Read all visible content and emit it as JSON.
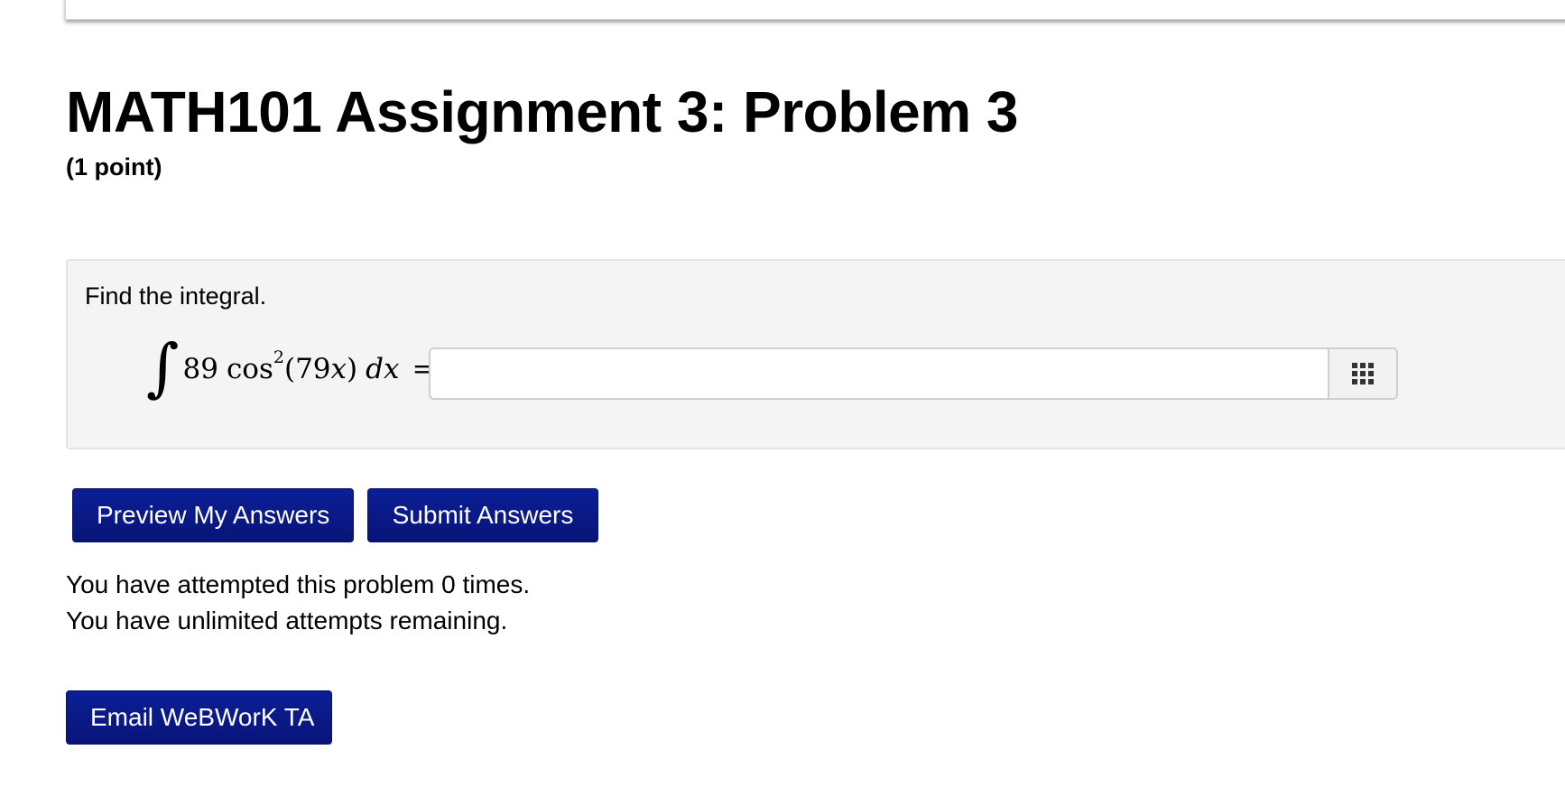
{
  "header": {
    "title": "MATH101 Assignment 3: Problem 3",
    "points": "(1 point)"
  },
  "problem": {
    "prompt": "Find the integral.",
    "integral": {
      "sign": "∫",
      "coefficient": "89",
      "function": "cos",
      "exponent": "2",
      "argument": "(79",
      "variable": "x",
      "argument_close": ")",
      "differential_d": "d",
      "differential_var": "x",
      "equals": "="
    },
    "answer_value": "",
    "palette_icon": "grid-icon"
  },
  "actions": {
    "preview_label": "Preview My Answers",
    "submit_label": "Submit Answers",
    "email_label": "Email WeBWorK TA"
  },
  "status": {
    "attempts_line": "You have attempted this problem 0 times.",
    "remaining_line": "You have unlimited attempts remaining."
  },
  "colors": {
    "button_bg": "#0b1f96",
    "problem_bg": "#f4f4f4"
  }
}
